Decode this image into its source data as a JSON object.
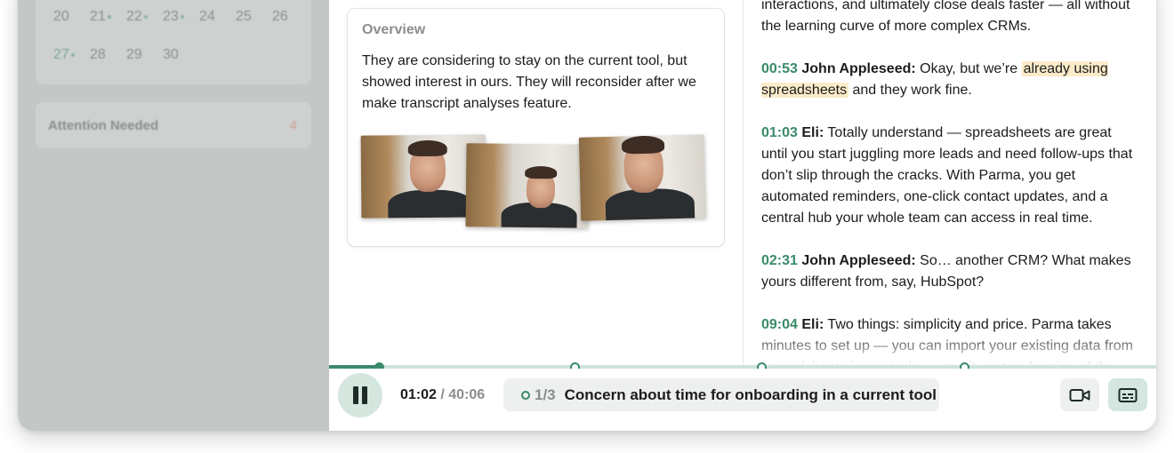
{
  "calendar": {
    "rows": [
      [
        {
          "day": "20"
        },
        {
          "day": "21",
          "dot": true
        },
        {
          "day": "22",
          "dot": true
        },
        {
          "day": "23",
          "dot": true
        },
        {
          "day": "24"
        },
        {
          "day": "25"
        },
        {
          "day": "26"
        }
      ],
      [
        {
          "day": "27",
          "dot": true,
          "today": true
        },
        {
          "day": "28"
        },
        {
          "day": "29"
        },
        {
          "day": "30"
        }
      ]
    ]
  },
  "attention": {
    "label": "Attention Needed",
    "count": "4"
  },
  "overview": {
    "title": "Overview",
    "text": "They are considering to stay on the current tool, but showed interest in ours. They will reconsider after we make transcript analyses feature."
  },
  "transcript": {
    "intro_text": "interactions, and ultimately close deals faster — all without the learning curve of more complex CRMs.",
    "entries": [
      {
        "time": "00:53",
        "speaker": "John Appleseed:",
        "text_before": "Okay, but we’re ",
        "highlight": "already using spreadsheets",
        "text_after": " and they work fine."
      },
      {
        "time": "01:03",
        "speaker": "Eli:",
        "text": "Totally understand — spreadsheets are great until you start juggling more leads and need follow-ups that don’t slip through the cracks. With Parma, you get automated reminders, one-click contact updates, and a central hub your whole team can access in real time."
      },
      {
        "time": "02:31",
        "speaker": "John Appleseed:",
        "text": "So… another CRM? What makes yours different from, say, HubSpot?"
      },
      {
        "time": "09:04",
        "speaker": "Eli:",
        "text": "Two things: simplicity and price. Parma takes minutes to set up — you can import your existing data from spreadsheets in seconds — and it costs a fraction of the cost."
      }
    ]
  },
  "player": {
    "current_time": "01:02",
    "total_time": "/ 40:06",
    "progress_fraction": 0.06,
    "chapter_markers": [
      0.06,
      0.297,
      0.523,
      0.768
    ],
    "chapter_index": "1/3",
    "chapter_title": "Concern about time for onboarding in a current tool"
  },
  "colors": {
    "accent": "#3a8a6a",
    "highlight": "#fbebc9",
    "attention": "#d2a191"
  },
  "icons": {
    "play_pause": "pause-icon",
    "video": "video-icon",
    "captions": "captions-icon"
  }
}
